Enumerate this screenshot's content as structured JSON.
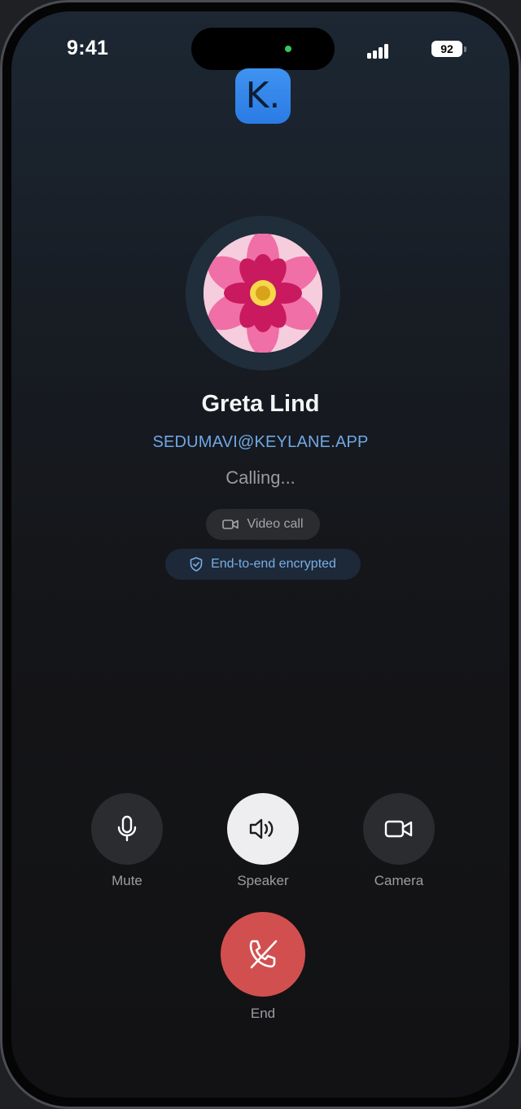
{
  "status_bar": {
    "time": "9:41",
    "battery_level": "92",
    "icons": [
      "cellular-signal-icon",
      "battery-icon"
    ]
  },
  "app": {
    "logo_letter": "K.",
    "logo_color": "#3a8cec"
  },
  "caller": {
    "name": "Greta Lind",
    "handle": "SEDUMAVI@KEYLANE.APP",
    "status": "Calling...",
    "avatar_icon": "flower-avatar"
  },
  "badges": {
    "call_type": "Video call",
    "encryption": "End-to-end encrypted"
  },
  "controls": {
    "mute_label": "Mute",
    "speaker_label": "Speaker",
    "camera_label": "Camera",
    "end_label": "End",
    "speaker_active": true
  },
  "colors": {
    "accent": "#6fa8e6",
    "end_call": "#d24f4f",
    "active_control": "#eeeef0"
  }
}
